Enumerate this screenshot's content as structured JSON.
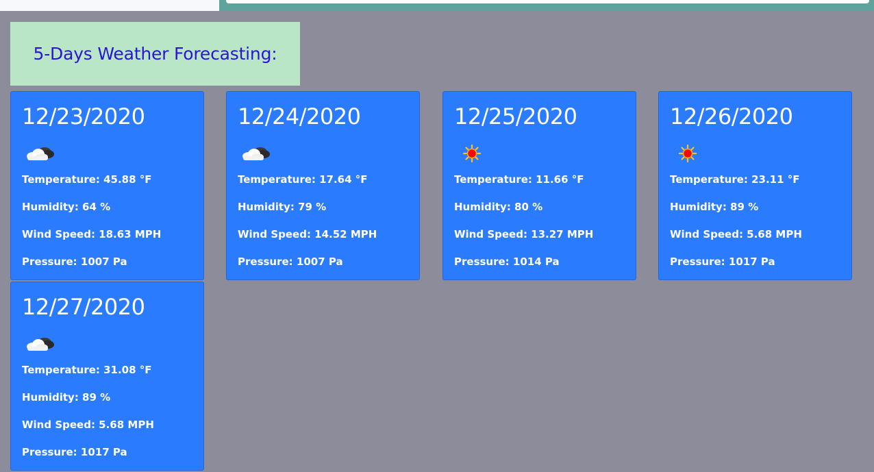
{
  "page": {
    "heading": "5-Days Weather Forecasting:"
  },
  "colors": {
    "background": "#8c8c9a",
    "card": "#2b7bff",
    "heading_box": "#b8e6c7",
    "heading_text": "#2a14d8",
    "top_bar": "#5fa39d"
  },
  "forecast": [
    {
      "date": "12/23/2020",
      "icon": "partly-cloudy-icon",
      "temperature": "Temperature: 45.88 °F",
      "humidity": "Humidity: 64 %",
      "wind": "Wind Speed: 18.63 MPH",
      "pressure": "Pressure: 1007 Pa"
    },
    {
      "date": "12/24/2020",
      "icon": "partly-cloudy-icon",
      "temperature": "Temperature: 17.64 °F",
      "humidity": "Humidity: 79 %",
      "wind": "Wind Speed: 14.52 MPH",
      "pressure": "Pressure: 1007 Pa"
    },
    {
      "date": "12/25/2020",
      "icon": "sun-icon",
      "temperature": "Temperature: 11.66 °F",
      "humidity": "Humidity: 80 %",
      "wind": "Wind Speed: 13.27 MPH",
      "pressure": "Pressure: 1014 Pa"
    },
    {
      "date": "12/26/2020",
      "icon": "sun-icon",
      "temperature": "Temperature: 23.11 °F",
      "humidity": "Humidity: 89 %",
      "wind": "Wind Speed: 5.68 MPH",
      "pressure": "Pressure: 1017 Pa"
    },
    {
      "date": "12/27/2020",
      "icon": "partly-cloudy-icon",
      "temperature": "Temperature: 31.08 °F",
      "humidity": "Humidity: 89 %",
      "wind": "Wind Speed: 5.68 MPH",
      "pressure": "Pressure: 1017 Pa"
    }
  ]
}
